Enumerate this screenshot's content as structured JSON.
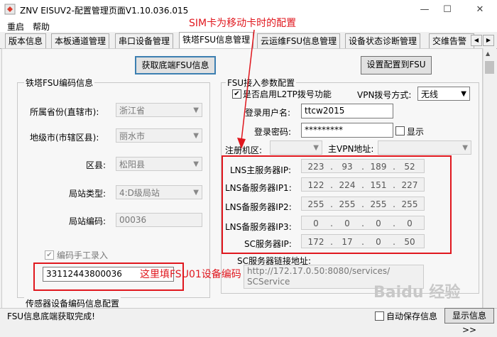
{
  "window": {
    "title": "ZNV EISUV2-配置管理页面V1.10.036.015",
    "controls": {
      "minimize": "—",
      "maximize": "☐",
      "close": "✕"
    }
  },
  "menu": {
    "restart": "重启",
    "help": "帮助"
  },
  "tabs": [
    "版本信息",
    "本板通道管理",
    "串口设备管理",
    "铁塔FSU信息管理",
    "云运维FSU信息管理",
    "设备状态诊断管理",
    "交维告警"
  ],
  "active_tab_index": 3,
  "buttons": {
    "get_fsu_info": "获取底端FSU信息",
    "set_config_to_fsu": "设置配置到FSU"
  },
  "fsu_code": {
    "group_title": "铁塔FSU编码信息",
    "province_label": "所属省份(直辖市):",
    "province_value": "浙江省",
    "city_label": "地级市(市辖区县):",
    "city_value": "丽水市",
    "county_label": "区县:",
    "county_value": "松阳县",
    "station_type_label": "局站类型:",
    "station_type_value": "4:D级局站",
    "station_code_label": "局站编码:",
    "station_code_value": "00036",
    "manual_entry_label": "编码手工录入",
    "manual_code_value": "33112443800036"
  },
  "fsu_access": {
    "group_title": "FSU接入参数配置",
    "l2tp_label": "是否启用L2TP拨号功能",
    "vpn_mode_label": "VPN拨号方式:",
    "vpn_mode_value": "无线",
    "username_label": "登录用户名:",
    "username_value": "ttcw2015",
    "password_label": "登录密码:",
    "password_value": "*********",
    "show_label": "显示",
    "register_area_label": "注册机区:",
    "main_vpn_label": "主VPN地址:",
    "servers": [
      {
        "label": "LNS主服务器IP:",
        "ip": [
          "223",
          "93",
          "189",
          "52"
        ]
      },
      {
        "label": "LNS备服务器IP1:",
        "ip": [
          "122",
          "224",
          "151",
          "227"
        ]
      },
      {
        "label": "LNS备服务器IP2:",
        "ip": [
          "255",
          "255",
          "255",
          "255"
        ]
      },
      {
        "label": "LNS备服务器IP3:",
        "ip": [
          "0",
          "0",
          "0",
          "0"
        ]
      },
      {
        "label": "SC服务器IP:",
        "ip": [
          "172",
          "17",
          "0",
          "50"
        ]
      }
    ],
    "sc_link_label": "SC服务器链接地址:",
    "sc_link_value_1": "http://172.17.0.50:8080/services/",
    "sc_link_value_2": "SCService"
  },
  "sensor_group_title": "传感器设备编码信息配置",
  "annotations": {
    "sim_note": "SIM卡为移动卡时的配置",
    "fill_note": "这里填FSU01设备编码"
  },
  "status": {
    "message": "FSU信息底端获取完成!",
    "auto_save_label": "自动保存信息",
    "show_info_button": "显示信息>>"
  },
  "watermark": "Baidu 经验"
}
